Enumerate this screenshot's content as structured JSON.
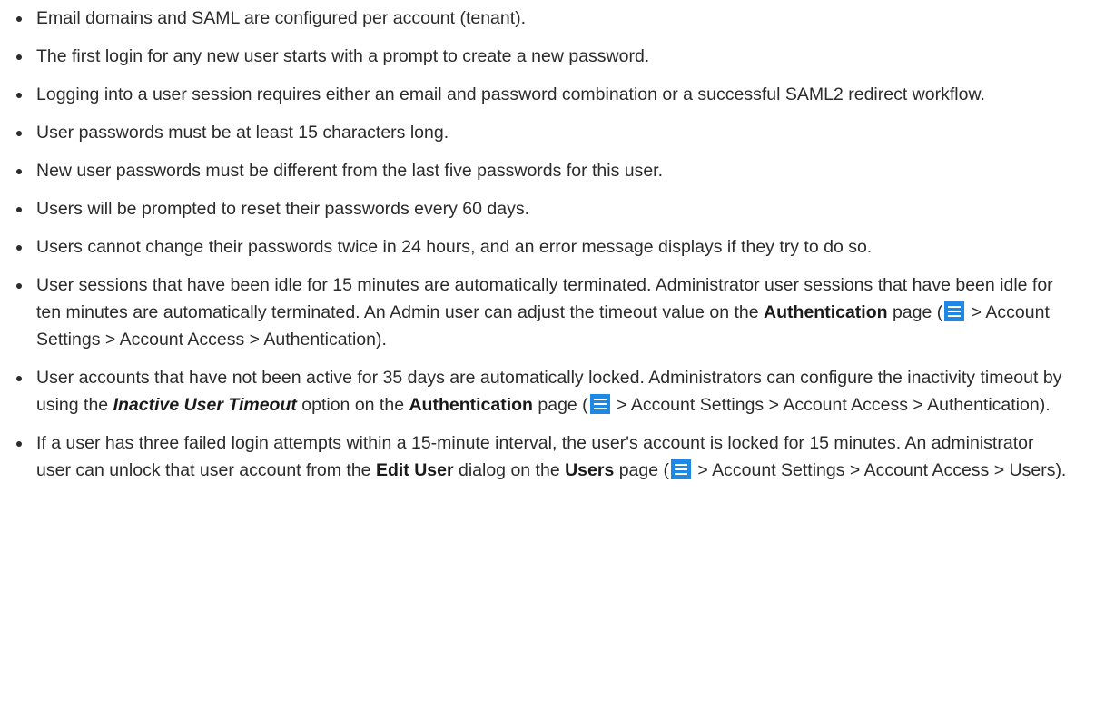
{
  "bullets": [
    {
      "text": "Email domains and SAML are configured per account (tenant)."
    },
    {
      "text": "The first login for any new user starts with a prompt to create a new password."
    },
    {
      "text": "Logging into a user session requires either an email and password combination or a successful SAML2 redirect workflow."
    },
    {
      "text": "User passwords must be at least 15 characters long."
    },
    {
      "text": "New user passwords must be different from the last five passwords for this user."
    },
    {
      "text": "Users will be prompted to reset their passwords every 60 days."
    },
    {
      "text": "Users cannot change their passwords twice in 24 hours, and an error message displays if they try to do so."
    },
    {
      "t1": "User sessions that have been idle for 15 minutes are automatically terminated. Administrator user sessions that have been idle for ten minutes are automatically terminated. An Admin user can adjust the timeout value on the ",
      "b1": "Authentication",
      "t2": " page (",
      "t3": " > Account Settings > Account Access > Authentication)."
    },
    {
      "t1": "User accounts that have not been active for 35 days are automatically locked. Administrators can configure the inactivity timeout by using the ",
      "i1": "Inactive User Timeout",
      "t2": " option on the ",
      "b1": "Authentication",
      "t3": " page (",
      "t4": " > Account Settings > Account Access > Authentication)."
    },
    {
      "t1": "If a user has three failed login attempts within a 15-minute interval, the user's account is locked for 15 minutes. An administrator user can unlock that user account from the ",
      "b1": "Edit User",
      "t2": " dialog on the ",
      "b2": "Users",
      "t3": " page (",
      "t4": " > Account Settings > Account Access > Users)."
    }
  ],
  "icons": {
    "menu": "hamburger-menu-icon",
    "menu_color": "#1e88e5"
  }
}
